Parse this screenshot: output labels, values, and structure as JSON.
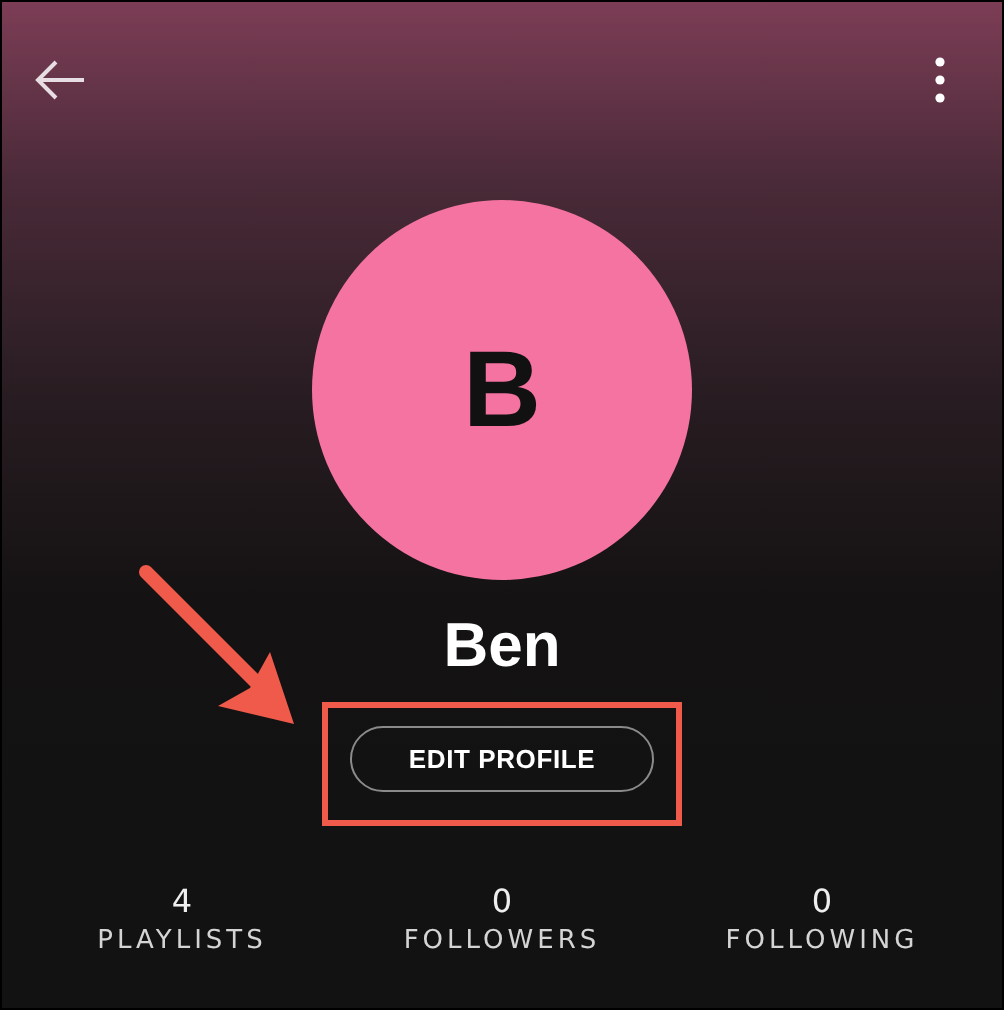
{
  "profile": {
    "initial": "B",
    "name": "Ben",
    "button": "EDIT PROFILE"
  },
  "stats": [
    {
      "value": "4",
      "label": "PLAYLISTS"
    },
    {
      "value": "0",
      "label": "FOLLOWERS"
    },
    {
      "value": "0",
      "label": "FOLLOWING"
    }
  ]
}
